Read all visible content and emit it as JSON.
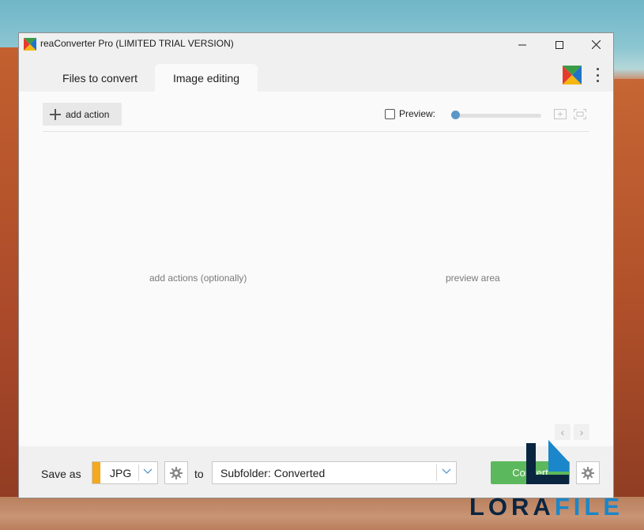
{
  "window": {
    "title": "reaConverter Pro  (LIMITED TRIAL VERSION)",
    "controls": {
      "minimize": "—",
      "maximize": "☐",
      "close": "✕"
    }
  },
  "tabs": [
    {
      "label": "Files to convert",
      "active": false
    },
    {
      "label": "Image editing",
      "active": true
    }
  ],
  "toolbar": {
    "add_action_label": "add action",
    "preview_label": "Preview:",
    "preview_checked": false,
    "zoom_level": 0
  },
  "main": {
    "actions_hint": "add actions (optionally)",
    "preview_hint": "preview area",
    "nav_prev": "‹",
    "nav_next": "›"
  },
  "bottom": {
    "save_as_label": "Save as",
    "format_value": "JPG",
    "to_label": "to",
    "destination_value": "Subfolder: Converted",
    "convert_label": "Convert"
  },
  "watermark": {
    "text_part1": "LORA",
    "text_part2": "FILE"
  },
  "colors": {
    "accent_format": "#f4a81d",
    "convert_button": "#5cb85c",
    "slider_thumb": "#5a97c9",
    "watermark_dark": "#0a2540",
    "watermark_blue": "#1b86c9"
  }
}
